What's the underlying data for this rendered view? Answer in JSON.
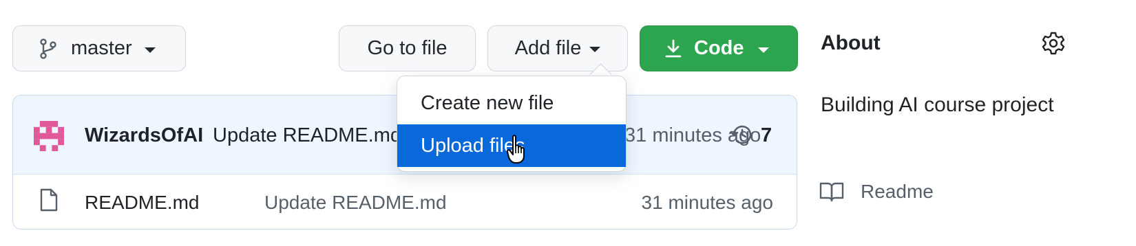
{
  "toolbar": {
    "branch_label": "master",
    "goto_label": "Go to file",
    "add_file_label": "Add file",
    "code_label": "Code"
  },
  "add_file_menu": {
    "items": [
      {
        "label": "Create new file",
        "selected": false
      },
      {
        "label": "Upload files",
        "selected": true
      }
    ]
  },
  "latest_commit": {
    "author": "WizardsOfAI",
    "message": "Update README.md",
    "time": "31 minutes ago",
    "commit_count": "7"
  },
  "files": [
    {
      "name": "README.md",
      "message": "Update README.md",
      "time": "31 minutes ago",
      "icon": "file-icon"
    }
  ],
  "about": {
    "title": "About",
    "description": "Building AI course project",
    "readme_label": "Readme"
  },
  "colors": {
    "code_button": "#2da44e",
    "menu_selected": "#0969da",
    "commit_row_bg": "#eef6ff",
    "avatar": "#e05a9b"
  }
}
